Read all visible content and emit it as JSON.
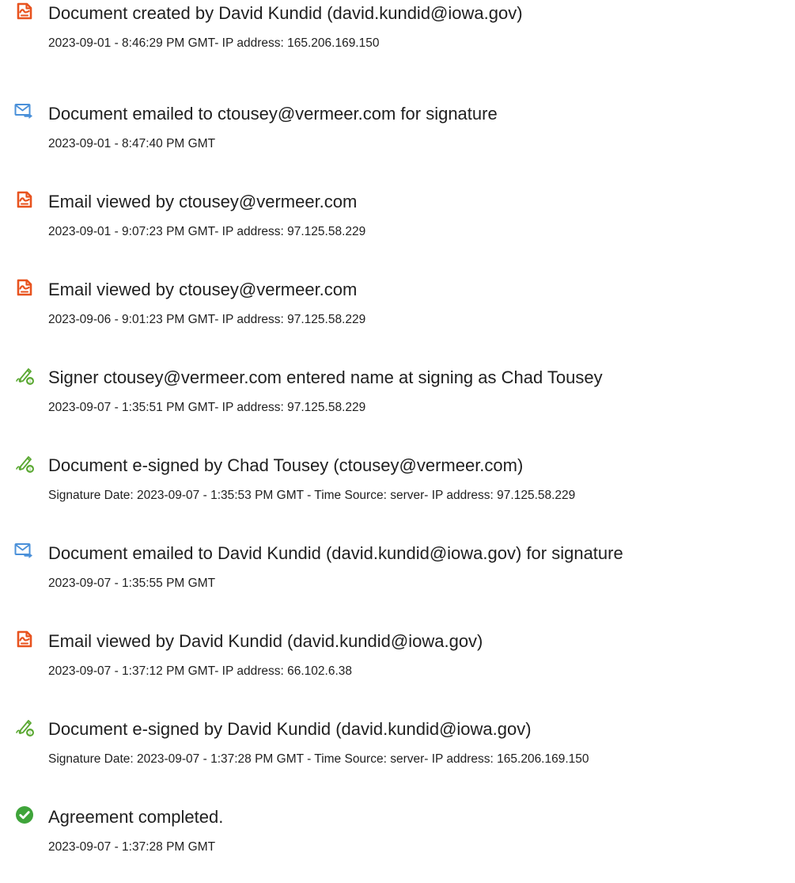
{
  "events": [
    {
      "icon": "document-icon",
      "title": "Document created by David Kundid (david.kundid@iowa.gov)",
      "detail": "2023-09-01 - 8:46:29 PM GMT- IP address: 165.206.169.150"
    },
    {
      "icon": "email-sent-icon",
      "title": "Document emailed to ctousey@vermeer.com for signature",
      "detail": "2023-09-01 - 8:47:40 PM GMT"
    },
    {
      "icon": "document-icon",
      "title": "Email viewed by ctousey@vermeer.com",
      "detail": "2023-09-01 - 9:07:23 PM GMT- IP address: 97.125.58.229"
    },
    {
      "icon": "document-icon",
      "title": "Email viewed by ctousey@vermeer.com",
      "detail": "2023-09-06 - 9:01:23 PM GMT- IP address: 97.125.58.229"
    },
    {
      "icon": "e-sign-pen-icon",
      "title": "Signer ctousey@vermeer.com entered name at signing as Chad Tousey",
      "detail": "2023-09-07 - 1:35:51 PM GMT- IP address: 97.125.58.229"
    },
    {
      "icon": "e-sign-pen-icon",
      "title": "Document e-signed by Chad Tousey (ctousey@vermeer.com)",
      "detail": "Signature Date: 2023-09-07 - 1:35:53 PM GMT - Time Source: server- IP address: 97.125.58.229"
    },
    {
      "icon": "email-sent-icon",
      "title": "Document emailed to David Kundid (david.kundid@iowa.gov) for signature",
      "detail": "2023-09-07 - 1:35:55 PM GMT"
    },
    {
      "icon": "document-icon",
      "title": "Email viewed by David Kundid (david.kundid@iowa.gov)",
      "detail": "2023-09-07 - 1:37:12 PM GMT- IP address: 66.102.6.38"
    },
    {
      "icon": "e-sign-pen-icon",
      "title": "Document e-signed by David Kundid (david.kundid@iowa.gov)",
      "detail": "Signature Date: 2023-09-07 - 1:37:28 PM GMT - Time Source: server- IP address: 165.206.169.150"
    },
    {
      "icon": "check-circle-icon",
      "title": "Agreement completed.",
      "detail": "2023-09-07 - 1:37:28 PM GMT"
    }
  ],
  "colors": {
    "document_icon": "#e8531f",
    "email_icon": "#4a90d9",
    "pen_icon": "#5aa832",
    "check_icon": "#3fa43a",
    "text": "#1f1f1f"
  }
}
